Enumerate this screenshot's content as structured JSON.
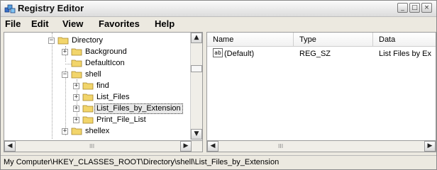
{
  "window": {
    "title": "Registry Editor",
    "app_icon": "regedit-icon"
  },
  "title_buttons": [
    {
      "name": "minimize-button",
      "glyph": "_"
    },
    {
      "name": "maximize-button",
      "glyph": "□"
    },
    {
      "name": "close-button",
      "glyph": "×"
    }
  ],
  "menu": {
    "file": "File",
    "edit": "Edit",
    "view": "View",
    "favorites": "Favorites",
    "help": "Help"
  },
  "tree": {
    "items": [
      {
        "label": "Directory",
        "expander": "−"
      },
      {
        "label": "Background",
        "expander": "+"
      },
      {
        "label": "DefaultIcon",
        "expander": ""
      },
      {
        "label": "shell",
        "expander": "−"
      },
      {
        "label": "find",
        "expander": "+"
      },
      {
        "label": "List_Files",
        "expander": "+"
      },
      {
        "label": "List_Files_by_Extension",
        "expander": "+",
        "selected": true
      },
      {
        "label": "Print_File_List",
        "expander": "+"
      },
      {
        "label": "shellex",
        "expander": "+"
      }
    ]
  },
  "list": {
    "columns": {
      "name": "Name",
      "type": "Type",
      "data": "Data"
    },
    "rows": [
      {
        "icon": "ab",
        "name": "(Default)",
        "type": "REG_SZ",
        "data": "List Files by Ex"
      }
    ]
  },
  "scroll": {
    "up": "▲",
    "down": "▼",
    "left": "◀",
    "right": "▶",
    "grip": "III"
  },
  "status": {
    "path": "My Computer\\HKEY_CLASSES_ROOT\\Directory\\shell\\List_Files_by_Extension"
  },
  "colors": {
    "selection_bg": "#e8e8e8",
    "folder": "#f2d56b",
    "window_bg": "#ece9e0"
  }
}
